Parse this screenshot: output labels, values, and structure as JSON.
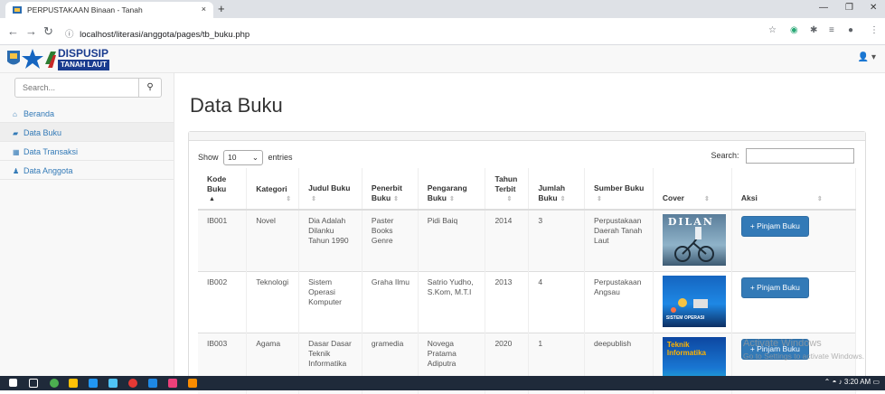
{
  "browser": {
    "tab_title": "PERPUSTAKAAN Binaan - Tanah",
    "tab_close": "×",
    "new_tab": "+",
    "url": "localhost/literasi/anggota/pages/tb_buku.php",
    "url_info": "ⓘ"
  },
  "header": {
    "logo_line1": "DISPUSIP",
    "logo_line2": "TANAH LAUT",
    "user_menu": "▾"
  },
  "sidebar": {
    "search_placeholder": "Search...",
    "search_icon": "search-icon",
    "items": [
      {
        "label": "Beranda",
        "icon": "home-icon"
      },
      {
        "label": "Data Buku",
        "icon": "book-icon"
      },
      {
        "label": "Data Transaksi",
        "icon": "table-icon"
      },
      {
        "label": "Data Anggota",
        "icon": "user-icon"
      }
    ]
  },
  "main": {
    "title": "Data Buku",
    "show_label": "Show",
    "entries_value": "10",
    "entries_label": "entries",
    "search_label": "Search:",
    "columns": [
      "Kode Buku",
      "Kategori",
      "Judul Buku",
      "Penerbit Buku",
      "Pengarang Buku",
      "Tahun Terbit",
      "Jumlah Buku",
      "Sumber Buku",
      "Cover",
      "Aksi"
    ],
    "rows": [
      {
        "kode": "IB001",
        "kategori": "Novel",
        "judul": "Dia Adalah Dilanku Tahun 1990",
        "penerbit": "Paster Books Genre",
        "pengarang": "Pidi Baiq",
        "tahun": "2014",
        "jumlah": "3",
        "sumber": "Perpustakaan Daerah Tanah Laut",
        "cover_text": "DILAN",
        "action": "+ Pinjam Buku"
      },
      {
        "kode": "IB002",
        "kategori": "Teknologi",
        "judul": "Sistem Operasi Komputer",
        "penerbit": "Graha Ilmu",
        "pengarang": "Satrio Yudho, S.Kom, M.T.I",
        "tahun": "2013",
        "jumlah": "4",
        "sumber": "Perpustakaan Angsau",
        "cover_text": "SISTEM OPERASI",
        "action": "+ Pinjam Buku"
      },
      {
        "kode": "IB003",
        "kategori": "Agama",
        "judul": "Dasar Dasar Teknik Informatika",
        "penerbit": "gramedia",
        "pengarang": "Novega Pratama Adiputra",
        "tahun": "2020",
        "jumlah": "1",
        "sumber": "deepublish",
        "cover_text": "Teknik Informatika",
        "action": "+ Pinjam Buku"
      }
    ]
  },
  "watermark": {
    "line1": "Activate Windows",
    "line2": "Go to Settings to activate Windows."
  },
  "taskbar": {
    "time": "3:20 AM"
  }
}
